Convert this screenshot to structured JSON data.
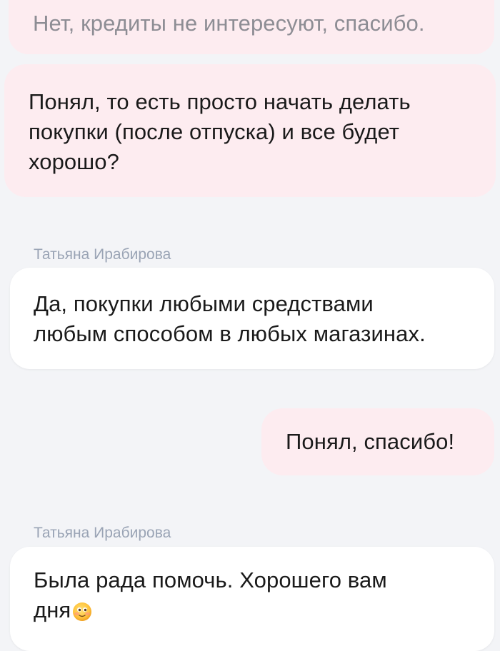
{
  "chat": {
    "messages": [
      {
        "role": "outgoing",
        "lines": [
          "Нет, кредиты не интересуют, спасибо."
        ]
      },
      {
        "role": "outgoing",
        "lines": [
          "Понял, то есть просто начать делать",
          "покупки (после отпуска) и все будет",
          "хорошо?"
        ]
      },
      {
        "role": "incoming",
        "sender": "Татьяна Ирабирова",
        "lines": [
          "Да, покупки любыми средствами",
          "любым способом в любых магазинах."
        ]
      },
      {
        "role": "outgoing",
        "lines": [
          "Понял, спасибо!"
        ]
      },
      {
        "role": "incoming",
        "sender": "Татьяна Ирабирова",
        "lines": [
          "Была рада помочь. Хорошего вам",
          "дня"
        ],
        "emoji": "smiling-face-emoji"
      }
    ]
  },
  "colors": {
    "background": "#f3f4f7",
    "outgoing_bubble": "#fdecf0",
    "incoming_bubble": "#ffffff",
    "sender_name": "#9aa4b5",
    "text": "#1a1a1a"
  }
}
